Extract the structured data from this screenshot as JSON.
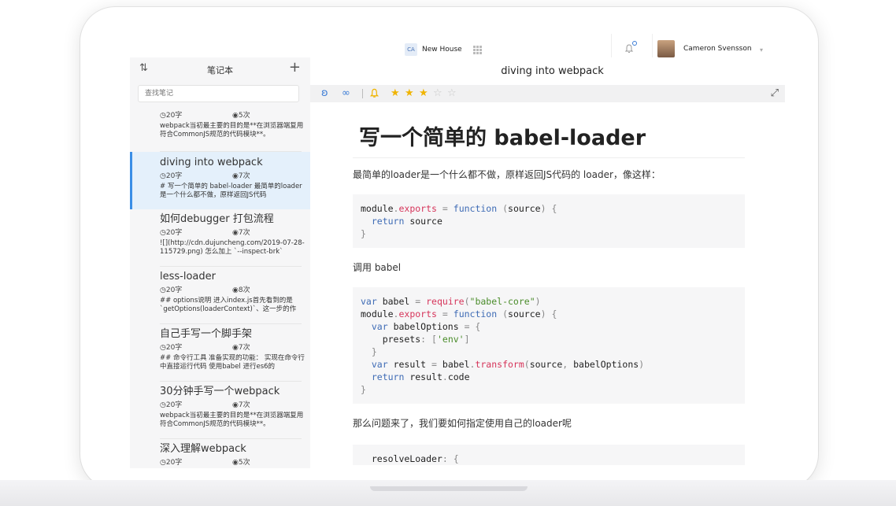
{
  "topbar": {
    "workspace_badge": "CA",
    "workspace_name": "New House",
    "user_name": "Cameron Svensson"
  },
  "sidebar": {
    "title": "笔记本",
    "search_placeholder": "查找笔记",
    "notes": [
      {
        "title": "",
        "words": "20字",
        "views": "5次",
        "excerpt": "webpack当初最主要的目的是**在浏览器端复用符合CommonJS规范的代码模块**。"
      },
      {
        "title": "diving into webpack",
        "words": "20字",
        "views": "7次",
        "excerpt": "# 写一个简单的 babel-loader 最简单的loader是一个什么都不做，原样返回JS代码"
      },
      {
        "title": "如何debugger 打包流程",
        "words": "20字",
        "views": "7次",
        "excerpt": "![](http://cdn.dujuncheng.com/2019-07-28-115729.png) 怎么加上 `--inspect-brk`"
      },
      {
        "title": "less-loader",
        "words": "20字",
        "views": "8次",
        "excerpt": "## options说明 进入index.js首先看到的是`getOptions(loaderContext)`、这一步的作"
      },
      {
        "title": "自己手写一个脚手架",
        "words": "20字",
        "views": "7次",
        "excerpt": "## 命令行工具 准备实现的功能： 实现在命令行中直接运行代码 使用babel 进行es6的"
      },
      {
        "title": "30分钟手写一个webpack",
        "words": "20字",
        "views": "7次",
        "excerpt": "webpack当初最主要的目的是**在浏览器端复用符合CommonJS规范的代码模块**。"
      },
      {
        "title": "深入理解webpack",
        "words": "20字",
        "views": "5次",
        "excerpt": ""
      }
    ]
  },
  "document": {
    "title": "diving into webpack",
    "rating": 3,
    "rating_max": 5,
    "heading": "写一个简单的 babel-loader",
    "para1": "最简单的loader是一个什么都不做，原样返回JS代码的 loader，像这样：",
    "para2": "调用 babel",
    "para3": "那么问题来了，我们要如何指定使用自己的loader呢",
    "code1": "module.exports = function (source) {\n  return source\n}",
    "code2": "var babel = require(\"babel-core\")\nmodule.exports = function (source) {\n  var babelOptions = {\n    presets: ['env']\n  }\n  var result = babel.transform(source, babelOptions)\n  return result.code\n}",
    "code3": "  resolveLoader: {"
  },
  "colors": {
    "accent": "#3a8ee6",
    "star": "#f0b400",
    "active_note_bg": "#e4f0fb"
  }
}
